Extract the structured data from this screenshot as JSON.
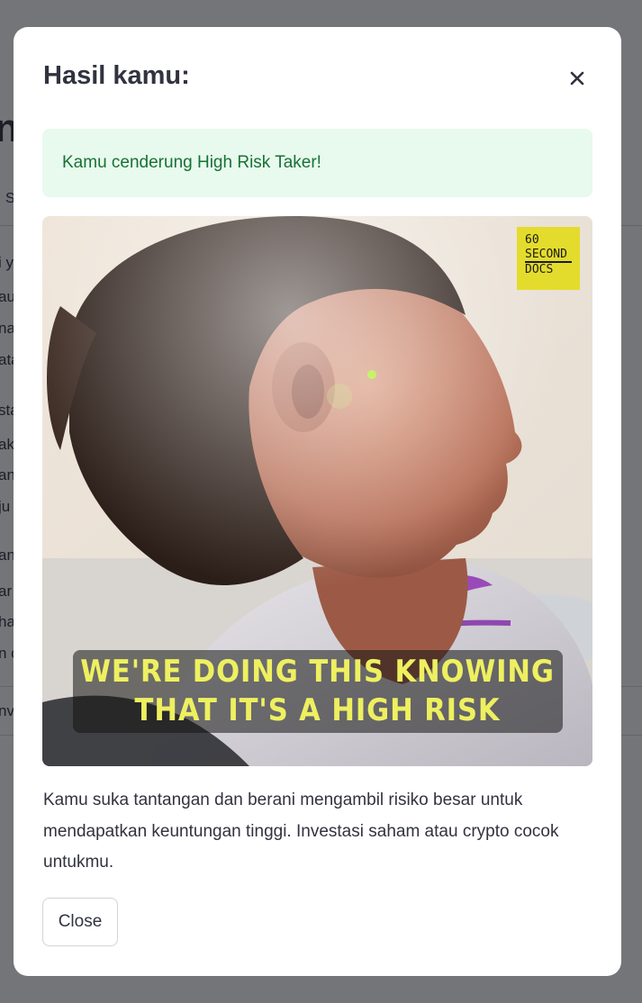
{
  "background_page": {
    "heading_fragment": "n",
    "tab_fragment": "S",
    "text_fragments": [
      "i y",
      "au",
      "na",
      "ata",
      "sta",
      "ak",
      "an",
      "ju",
      "an",
      "ar",
      "ha",
      "n c",
      "nv"
    ]
  },
  "dialog": {
    "title": "Hasil kamu:",
    "close_icon": "close-x-icon",
    "alert_text": "Kamu cenderung High Risk Taker!",
    "media": {
      "logo_lines": [
        "60",
        "SECOND",
        "DOCS"
      ],
      "caption_lines": [
        "WE'RE DOING THIS KNOWING",
        "THAT IT'S A HIGH RISK"
      ]
    },
    "description": "Kamu suka tantangan dan berani mengambil risiko besar untuk mendapatkan keuntungan tinggi. Investasi saham atau crypto cocok untukmu.",
    "close_button_label": "Close"
  },
  "colors": {
    "overlay": "#0e1117",
    "success_background": "#e8f9ee",
    "success_text": "#177233",
    "text": "#31333f",
    "logo_yellow": "#e4dc2c",
    "caption_yellow": "#eef060"
  }
}
